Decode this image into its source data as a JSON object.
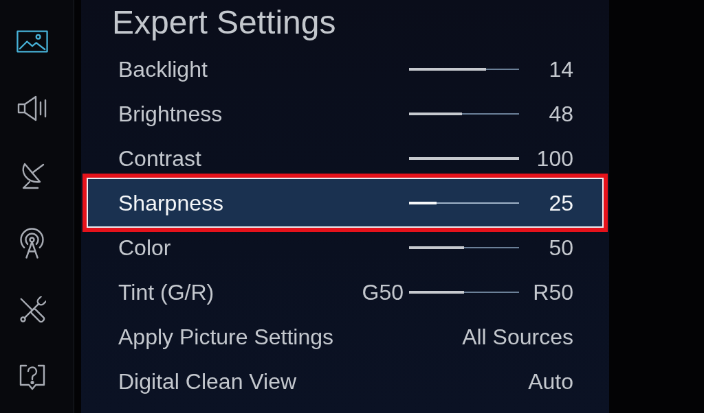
{
  "sidebar": {
    "items": [
      {
        "kind": "picture",
        "selected": true
      },
      {
        "kind": "sound",
        "selected": false
      },
      {
        "kind": "broadcasting",
        "selected": false
      },
      {
        "kind": "network",
        "selected": false
      },
      {
        "kind": "system",
        "selected": false
      },
      {
        "kind": "support",
        "selected": false
      }
    ]
  },
  "title": "Expert Settings",
  "settings": [
    {
      "kind": "slider",
      "label": "Backlight",
      "level": 0.7,
      "value": "14",
      "selected": false
    },
    {
      "kind": "slider",
      "label": "Brightness",
      "level": 0.48,
      "value": "48",
      "selected": false
    },
    {
      "kind": "slider",
      "label": "Contrast",
      "level": 1,
      "value": "100",
      "selected": false
    },
    {
      "kind": "slider",
      "label": "Sharpness",
      "level": 0.25,
      "value": "25",
      "selected": true
    },
    {
      "kind": "slider",
      "label": "Color",
      "level": 0.5,
      "value": "50",
      "selected": false
    },
    {
      "kind": "balance",
      "label": "Tint (G/R)",
      "left_value": "G50",
      "level": 0.5,
      "value": "R50",
      "selected": false
    },
    {
      "kind": "option",
      "label": "Apply Picture Settings",
      "value": "All Sources",
      "selected": false
    },
    {
      "kind": "option",
      "label": "Digital Clean View",
      "value": "Auto",
      "selected": false
    }
  ]
}
